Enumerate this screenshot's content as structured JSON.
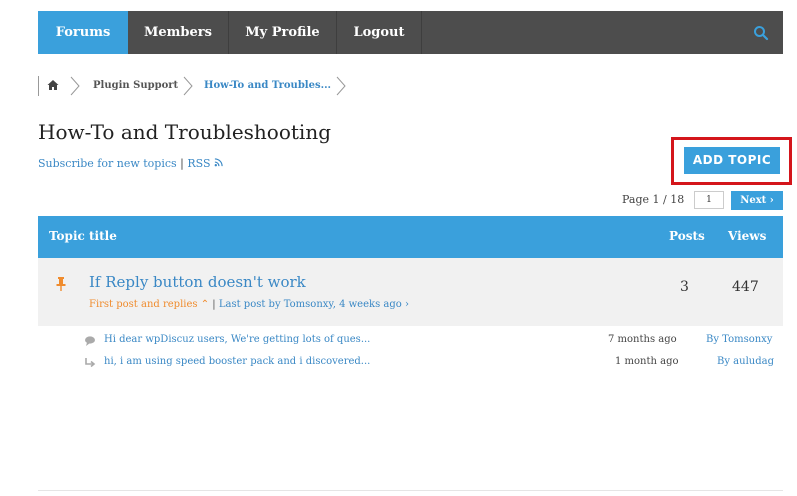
{
  "nav": {
    "tabs": [
      {
        "label": "Forums",
        "active": true
      },
      {
        "label": "Members"
      },
      {
        "label": "My Profile"
      },
      {
        "label": "Logout"
      }
    ],
    "search_icon": "search-icon",
    "bar_color": "#4d4d4d",
    "accent_color": "#3aa0dc"
  },
  "breadcrumb": {
    "home_icon": "home-icon",
    "items": [
      "Plugin Support",
      "How-To and Troubles..."
    ]
  },
  "forum": {
    "title": "How-To and Troubleshooting",
    "subscribe": "Subscribe for new topics",
    "separator": "|",
    "rss": "RSS",
    "rss_icon": "rss-icon",
    "add_topic": "ADD TOPIC",
    "highlight_color": "#d4151b"
  },
  "pagination": {
    "label": "Page 1 / 18",
    "current": "1",
    "next": "Next"
  },
  "table": {
    "headers": {
      "title": "Topic title",
      "posts": "Posts",
      "views": "Views"
    },
    "topic": {
      "title": "If Reply button doesn't work",
      "first_post": "First post and replies",
      "separator": "|",
      "last_post": "Last post by Tomsonxy, 4 weeks ago",
      "posts": "3",
      "views": "447",
      "pinned_icon": "pin-icon"
    },
    "replies": [
      {
        "icon": "comment-icon",
        "text": "Hi dear wpDiscuz users, We're getting lots of ques...",
        "time": "7 months ago",
        "by": "By Tomsonxy"
      },
      {
        "icon": "reply-arrow-icon",
        "text": "hi, i am using speed booster pack and i discovered...",
        "time": "1 month ago",
        "by": "By auludag"
      }
    ]
  }
}
